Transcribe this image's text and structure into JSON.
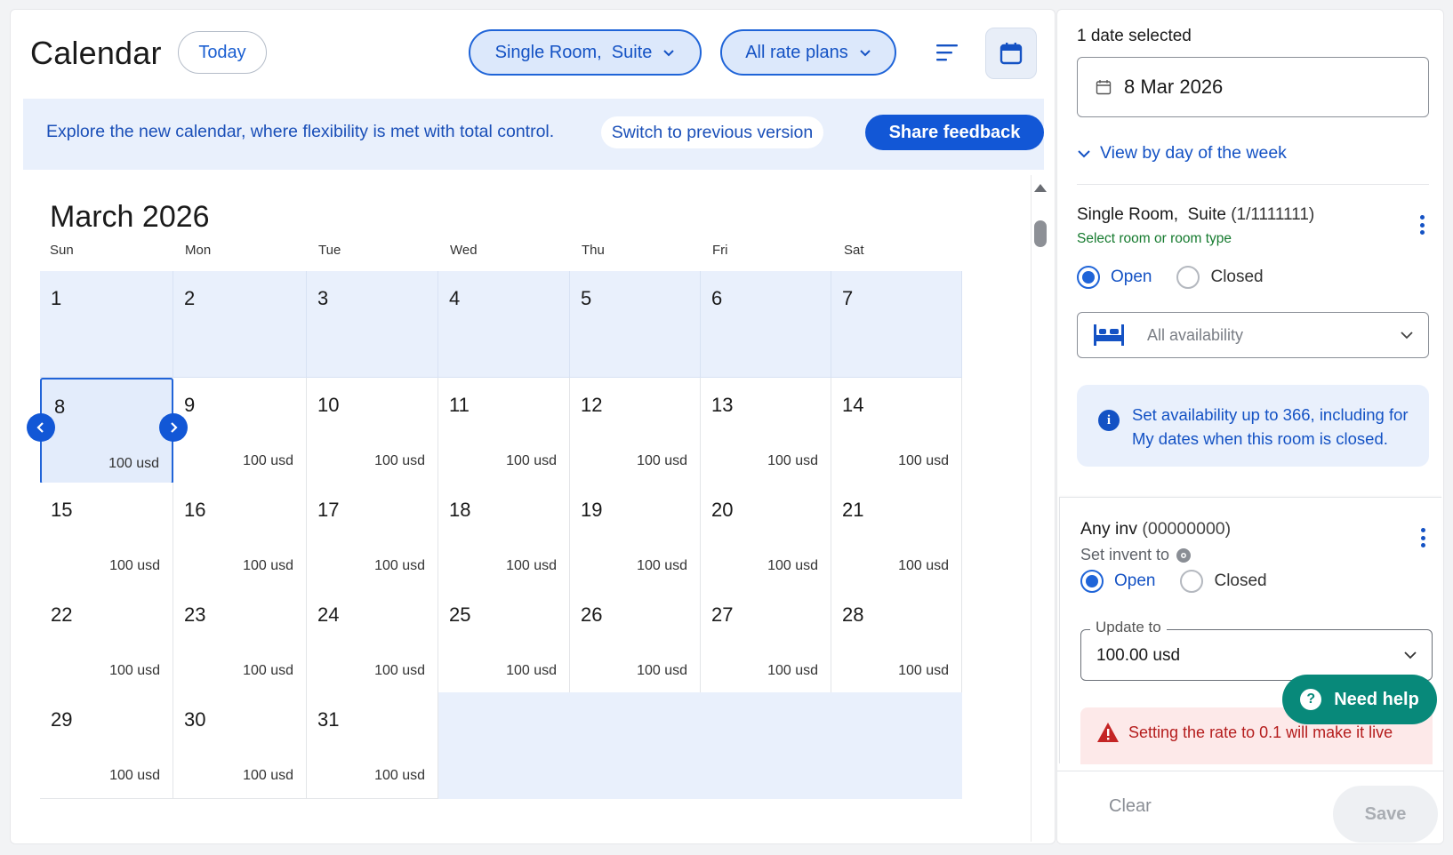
{
  "header": {
    "title": "Calendar",
    "today_label": "Today",
    "room_filter_label": "Single Room,  Suite",
    "rate_filter_label": "All rate plans"
  },
  "banner": {
    "text": "Explore the new calendar, where flexibility is met with total control.",
    "switch_label": "Switch to previous version",
    "feedback_label": "Share feedback"
  },
  "calendar": {
    "month_title": "March 2026",
    "weekdays": [
      "Sun",
      "Mon",
      "Tue",
      "Wed",
      "Thu",
      "Fri",
      "Sat"
    ],
    "weeks": [
      [
        {
          "day": "1",
          "price": ""
        },
        {
          "day": "2",
          "price": ""
        },
        {
          "day": "3",
          "price": ""
        },
        {
          "day": "4",
          "price": ""
        },
        {
          "day": "5",
          "price": ""
        },
        {
          "day": "6",
          "price": ""
        },
        {
          "day": "7",
          "price": ""
        }
      ],
      [
        {
          "day": "8",
          "price": "100 usd"
        },
        {
          "day": "9",
          "price": "100 usd"
        },
        {
          "day": "10",
          "price": "100 usd"
        },
        {
          "day": "11",
          "price": "100 usd"
        },
        {
          "day": "12",
          "price": "100 usd"
        },
        {
          "day": "13",
          "price": "100 usd"
        },
        {
          "day": "14",
          "price": "100 usd"
        }
      ],
      [
        {
          "day": "15",
          "price": "100 usd"
        },
        {
          "day": "16",
          "price": "100 usd"
        },
        {
          "day": "17",
          "price": "100 usd"
        },
        {
          "day": "18",
          "price": "100 usd"
        },
        {
          "day": "19",
          "price": "100 usd"
        },
        {
          "day": "20",
          "price": "100 usd"
        },
        {
          "day": "21",
          "price": "100 usd"
        }
      ],
      [
        {
          "day": "22",
          "price": "100 usd"
        },
        {
          "day": "23",
          "price": "100 usd"
        },
        {
          "day": "24",
          "price": "100 usd"
        },
        {
          "day": "25",
          "price": "100 usd"
        },
        {
          "day": "26",
          "price": "100 usd"
        },
        {
          "day": "27",
          "price": "100 usd"
        },
        {
          "day": "28",
          "price": "100 usd"
        }
      ],
      [
        {
          "day": "29",
          "price": "100 usd"
        },
        {
          "day": "30",
          "price": "100 usd"
        },
        {
          "day": "31",
          "price": "100 usd"
        }
      ]
    ],
    "selected_day": "8"
  },
  "sidebar": {
    "heading": "1 date selected",
    "date_value": "8 Mar 2026",
    "view_by_label": "View by day of the week",
    "room": {
      "name": "Single Room,  Suite",
      "code": "(1/1111111)",
      "subtitle": "Select room or room type",
      "open_label": "Open",
      "closed_label": "Closed",
      "availability_placeholder": "All availability",
      "info_text": "Set availability up to 366, including for My dates when this room is closed."
    },
    "inventory": {
      "name": "Any inv",
      "code": "(00000000)",
      "subtitle": "Set invent to",
      "open_label": "Open",
      "closed_label": "Closed",
      "update_label": "Update to",
      "update_value": "100.00 usd",
      "warning_text": "Setting the rate to 0.1 will make it live"
    },
    "help_label": "Need help",
    "clear_label": "Clear",
    "save_label": "Save"
  },
  "colors": {
    "accent": "#1257d6",
    "accent_light": "#dce8fb",
    "banner_bg": "#e9f0fc",
    "success": "#157a2e",
    "danger": "#b51d1d",
    "help_bg": "#08897a"
  },
  "icons": [
    "chevron-down-icon",
    "list-view-icon",
    "calendar-icon",
    "chevron-left-icon",
    "chevron-right-icon",
    "more-vertical-icon",
    "bed-icon",
    "info-icon",
    "warning-icon",
    "help-icon",
    "gear-icon"
  ]
}
